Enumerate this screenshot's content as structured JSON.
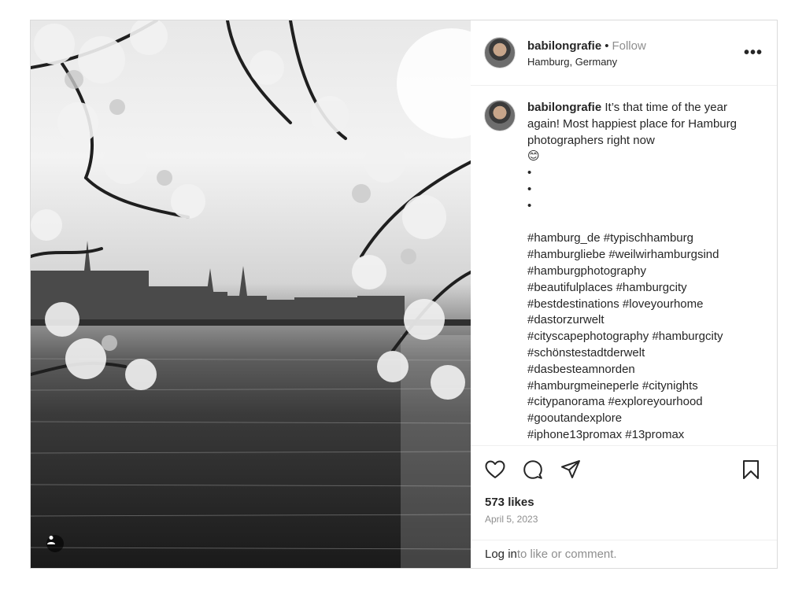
{
  "post": {
    "username": "babilongrafie",
    "separator": "•",
    "follow_label": "Follow",
    "location": "Hamburg, Germany",
    "more_label": "•••",
    "caption": {
      "username": "babilongrafie",
      "text": "It’s that time of the year again! Most happiest place for Hamburg photographers right now",
      "emoji": "😊",
      "bullets": [
        "•",
        "•",
        "•"
      ],
      "hashtags": "#hamburg_de #typischhamburg\n#hamburgliebe #weilwirhamburgsind\n#hamburgphotography\n#beautifulplaces #hamburgcity\n#bestdestinations #loveyourhome\n#dastorzurwelt\n#cityscapephotography #hamburgcity\n#schönstestadtderwelt\n#dasbesteamnorden\n#hamburgmeineperle #citynights\n#citypanorama #exploreyourhood\n#gooutandexplore\n#iphone13promax #13promax"
    },
    "likes": "573 likes",
    "date": "April 5, 2023",
    "login": {
      "link": "Log in",
      "text": " to like or comment."
    },
    "icons": {
      "like": "heart-icon",
      "comment": "comment-icon",
      "share": "share-icon",
      "save": "bookmark-icon",
      "user_tag": "user-tag-icon"
    }
  }
}
